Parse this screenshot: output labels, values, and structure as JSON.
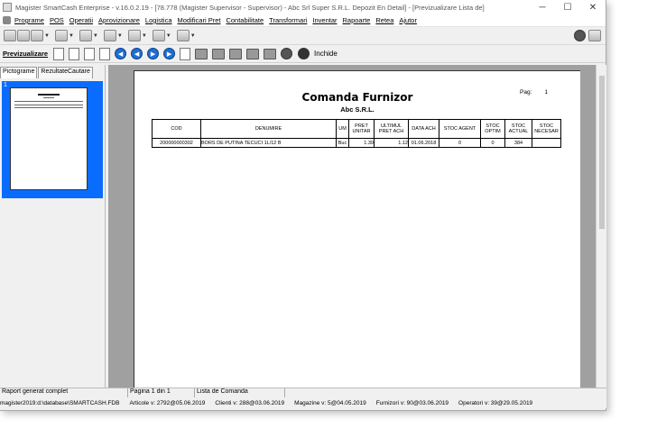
{
  "window": {
    "title": "Magister SmartCash Enterprise - v.16.0.2.19 - [78.778 (Magister Supervisor - Supervisor) - Abc Srl Super S.R.L. Depozit En Detail] - [Previzualizare Lista de]",
    "controls": [
      "─",
      "☐",
      "✕"
    ]
  },
  "menu": [
    "Programe",
    "POS",
    "Operatii",
    "Aprovizionare",
    "Logistica",
    "Modificari Pret",
    "Contabilitate",
    "Transformari",
    "Inventar",
    "Rapoarte",
    "Retea",
    "Ajutor"
  ],
  "preview_toolbar": {
    "label": "Previzualizare",
    "close_label": "Inchide"
  },
  "side_panel": {
    "tabs": [
      "Pictograme",
      "RezultateCautare"
    ],
    "thumb_number": "1"
  },
  "report": {
    "title": "Comanda Furnizor",
    "company": "Abc S.R.L.",
    "page_label": "Pag:",
    "page_number": "1",
    "columns": [
      "COD",
      "DENUMIRE",
      "UM",
      "PRET UNITAR",
      "ULTIMUL PRET ACH",
      "DATA ACH",
      "STOC AGENT",
      "STOC OPTIM",
      "STOC ACTUAL",
      "STOC NECESAR"
    ],
    "rows": [
      [
        "200000000302",
        "BORS DE PUTINA TECUCI 1L/12 B",
        "Buc",
        "1.39",
        "1.12",
        "01.06.2018",
        "0",
        "0",
        "384",
        ""
      ]
    ]
  },
  "status": {
    "message": "Raport generat complet",
    "page": "Pagina 1 din 1",
    "doc": "Lista de Comanda"
  },
  "status2": [
    "magister2019:d:\\database\\SMARTCASH.FDB",
    "Articole v: 2792@05.06.2019",
    "Clienti v: 288@03.06.2019",
    "Magazine v: 5@04.05.2019",
    "Furnizori v: 90@03.06.2019",
    "Operatori v: 39@29.05.2019"
  ]
}
